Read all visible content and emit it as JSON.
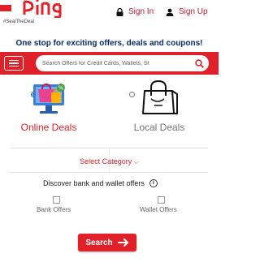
{
  "header": {
    "logo_tagline": "#SealTheDeal",
    "sign_in_label": "Sign In",
    "sign_up_label": "Sign Up",
    "tagline": "One stop for exciting offers, deals and coupons!"
  },
  "search": {
    "placeholder": "Search Offers for Credit Cards, Wallets, St"
  },
  "deal_types": [
    {
      "label": "Online Deals",
      "selected": true
    },
    {
      "label": "Local Deals",
      "selected": false
    }
  ],
  "filters": {
    "select_category_label": "Select Category",
    "discover_label": "Discover bank and wallet offers",
    "bank_offers_label": "Bank Offers",
    "wallet_offers_label": "Wallet Offers"
  },
  "actions": {
    "search_button_label": "Search"
  },
  "colors": {
    "brand_red": "#e0212a",
    "tagline_navy": "#0a2a6b",
    "radio_blue": "#1e4fd6"
  }
}
